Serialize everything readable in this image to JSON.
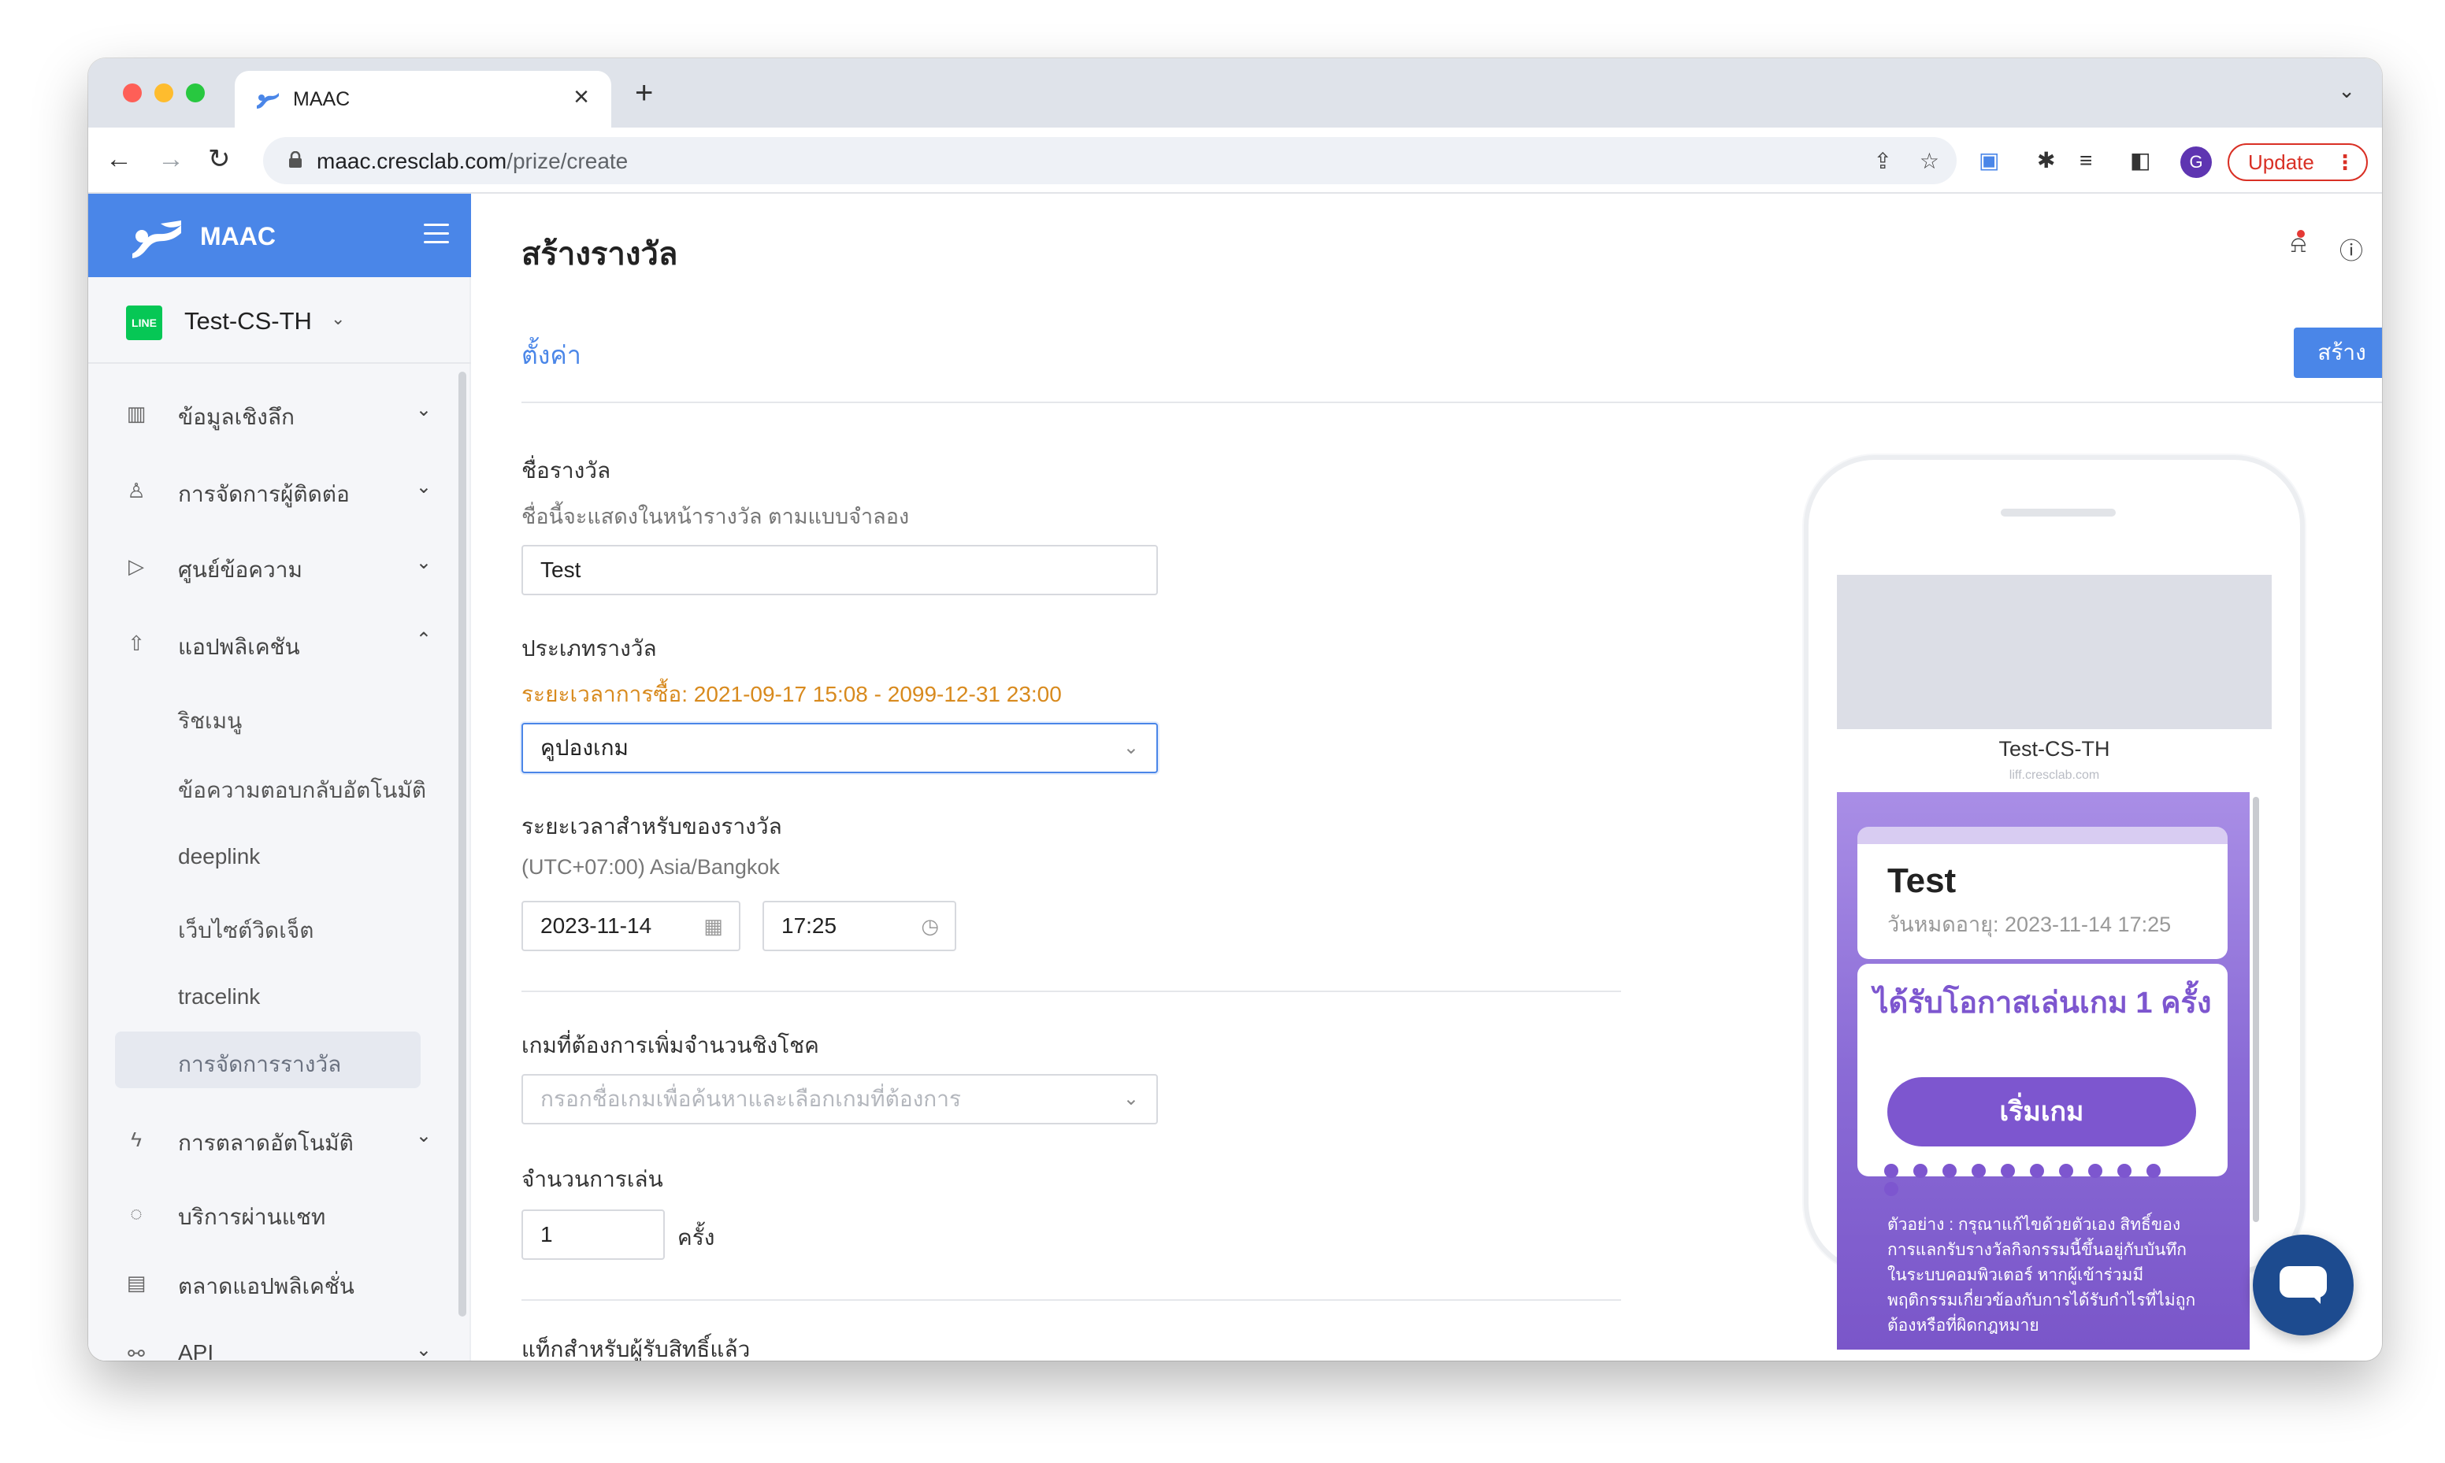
{
  "browser": {
    "tab_title": "MAAC",
    "new_tab": "+",
    "close_tab": "×",
    "url_host": "maac.cresclab.com",
    "url_path": "/prize/create",
    "profile_initial": "G",
    "update_label": "Update",
    "update_menu": "⋮"
  },
  "sidebar": {
    "brand": "MAAC",
    "account_logo": "LINE",
    "account_name": "Test-CS-TH",
    "items": [
      {
        "label": "ข้อมูลเชิงลึก",
        "icon": "chart-icon",
        "expanded": false
      },
      {
        "label": "การจัดการผู้ติดต่อ",
        "icon": "user-icon",
        "expanded": false
      },
      {
        "label": "ศูนย์ข้อความ",
        "icon": "send-icon",
        "expanded": false
      },
      {
        "label": "แอปพลิเคชัน",
        "icon": "rocket-icon",
        "expanded": true
      },
      {
        "label": "การตลาดอัตโนมัติ",
        "icon": "bolt-icon",
        "expanded": false
      },
      {
        "label": "บริการผ่านแชท",
        "icon": "chat-icon",
        "expanded": false
      },
      {
        "label": "ตลาดแอปพลิเคชั่น",
        "icon": "store-icon",
        "expanded": false
      },
      {
        "label": "API",
        "icon": "api-icon",
        "expanded": false
      }
    ],
    "subitems": [
      {
        "label": "ริชเมนู"
      },
      {
        "label": "ข้อความตอบกลับอัตโนมัติ"
      },
      {
        "label": "deeplink"
      },
      {
        "label": "เว็บไซต์วิดเจ็ต"
      },
      {
        "label": "tracelink"
      },
      {
        "label": "การจัดการรางวัล",
        "active": true
      }
    ]
  },
  "main": {
    "title": "สร้างรางวัล",
    "settings_tab": "ตั้งค่า",
    "create_button": "สร้าง",
    "prize_name_label": "ชื่อรางวัล",
    "prize_name_hint": "ชื่อนี้จะแสดงในหน้ารางวัล ตามแบบจำลอง",
    "prize_name_value": "Test",
    "prize_type_label": "ประเภทรางวัล",
    "prize_type_warning": "ระยะเวลาการซื้อ: 2021-09-17 15:08 - 2099-12-31 23:00",
    "prize_type_value": "คูปองเกม",
    "period_label": "ระยะเวลาสำหรับของรางวัล",
    "timezone": "(UTC+07:00) Asia/Bangkok",
    "date_value": "2023-11-14",
    "time_value": "17:25",
    "games_label": "เกมที่ต้องการเพิ่มจำนวนชิงโชค",
    "games_placeholder": "กรอกชื่อเกมเพื่อค้นหาและเลือกเกมที่ต้องการ",
    "plays_label": "จำนวนการเล่น",
    "plays_value": "1",
    "plays_unit": "ครั้ง",
    "tag_label": "แท็กสำหรับผู้รับสิทธิ์แล้ว"
  },
  "preview": {
    "account_name": "Test-CS-TH",
    "account_url": "liff.cresclab.com",
    "prize_title": "Test",
    "expiry": "วันหมดอายุ: 2023-11-14 17:25",
    "chance_text": "ได้รับโอกาสเล่นเกม 1 ครั้ง",
    "start_button": "เริ่มเกม",
    "terms": "ตัวอย่าง : กรุณาแก้ไขด้วยตัวเอง สิทธิ์ของการแลกรับรางวัลกิจกรรมนี้ขึ้นอยู่กับบันทึกในระบบคอมพิวเตอร์ หากผู้เข้าร่วมมีพฤติกรรมเกี่ยวข้องกับการได้รับกำไรที่ไม่ถูกต้องหรือที่ผิดกฎหมาย"
  },
  "colors": {
    "brand_blue": "#4a86e8",
    "line_green": "#06c755",
    "preview_purple": "#7d56cf",
    "warning_orange": "#d88a1e",
    "update_red": "#d93025"
  }
}
